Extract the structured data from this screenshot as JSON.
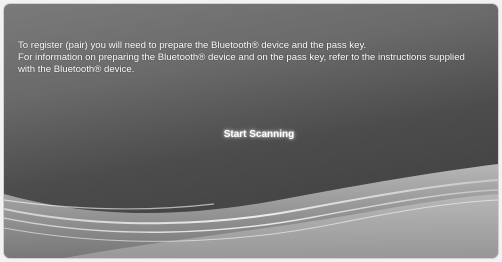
{
  "dialog": {
    "message_lines": [
      "To register (pair) you will need to prepare the Bluetooth® device and the pass key.",
      "For information on preparing the Bluetooth® device and on the pass key, refer to the instructions supplied",
      "with the Bluetooth® device."
    ],
    "start_button_label": "Start Scanning"
  },
  "colors": {
    "background_gradient_top": "#7a7a7a",
    "background_gradient_bottom": "#3a3a3a",
    "text": "#ffffff"
  }
}
